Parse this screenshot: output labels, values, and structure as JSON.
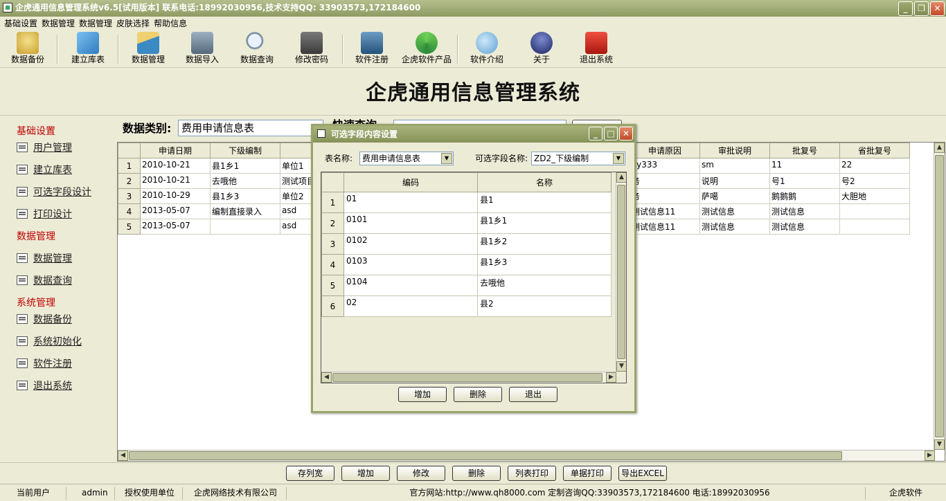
{
  "window": {
    "title": "企虎通用信息管理系统v6.5[试用版本]   联系电话:18992030956,技术支持QQ: 33903573,172184600"
  },
  "menu": [
    "基础设置",
    "数据管理",
    "数据管理",
    "皮肤选择",
    "帮助信息"
  ],
  "toolbar": [
    {
      "label": "数据备份",
      "icon": "database-backup-icon",
      "color": "#d9b23a"
    },
    {
      "label": "建立库表",
      "icon": "create-table-icon",
      "color": "#3c8fd8"
    },
    {
      "label": "数据管理",
      "icon": "data-manage-icon",
      "color": "#3b8ac4"
    },
    {
      "label": "数据导入",
      "icon": "data-import-icon",
      "color": "#6a7f95"
    },
    {
      "label": "数据查询",
      "icon": "magnifier-icon",
      "color": "#9fb4c7"
    },
    {
      "label": "修改密码",
      "icon": "key-icon",
      "color": "#5a5a5a"
    },
    {
      "label": "软件注册",
      "icon": "register-icon",
      "color": "#3a6f9c"
    },
    {
      "label": "企虎软件产品",
      "icon": "refresh-icon",
      "color": "#3fa04a"
    },
    {
      "label": "软件介绍",
      "icon": "chat-icon",
      "color": "#6ab0e0"
    },
    {
      "label": "关于",
      "icon": "about-icon",
      "color": "#2d3b7a"
    },
    {
      "label": "退出系统",
      "icon": "exit-icon",
      "color": "#d42a1e"
    }
  ],
  "banner": {
    "title": "企虎通用信息管理系统"
  },
  "sidebar": {
    "groups": [
      {
        "title": "基础设置",
        "items": [
          "用户管理",
          "建立库表",
          "可选字段设计",
          "打印设计"
        ]
      },
      {
        "title": "数据管理",
        "items": [
          "数据管理",
          "数据查询"
        ]
      },
      {
        "title": "系统管理",
        "items": [
          "数据备份",
          "系统初始化",
          "软件注册",
          "退出系统"
        ]
      }
    ]
  },
  "main": {
    "data_type_label": "数据类别:",
    "data_type_value": "费用申请信息表",
    "quick_query_label": "快速查询",
    "columns": [
      "",
      "申请日期",
      "下级编制",
      "单",
      "",
      "",
      "",
      "",
      "申请原因",
      "审批说明",
      "批复号",
      "省批复号"
    ],
    "rows": [
      [
        "1",
        "2010-10-21",
        "县1乡1",
        "单位1",
        "",
        "",
        "",
        "",
        "yy333",
        "sm",
        "11",
        "22"
      ],
      [
        "2",
        "2010-10-21",
        "去哦他",
        "测试项目",
        "",
        "",
        "",
        "",
        "务",
        "说明",
        "号1",
        "号2"
      ],
      [
        "3",
        "2010-10-29",
        "县1乡3",
        "单位2",
        "",
        "",
        "",
        "",
        "务",
        "萨噶",
        "鹅鹅鹅",
        "大胆地"
      ],
      [
        "4",
        "2013-05-07",
        "编制直接录入",
        "asd",
        "",
        "",
        "",
        "",
        "测试信息11",
        "测试信息",
        "测试信息",
        ""
      ],
      [
        "5",
        "2013-05-07",
        "",
        "asd",
        "",
        "",
        "",
        "",
        "测试信息11",
        "测试信息",
        "测试信息",
        ""
      ]
    ]
  },
  "bottom_buttons": [
    "存列宽",
    "增加",
    "修改",
    "删除",
    "列表打印",
    "单据打印",
    "导出EXCEL"
  ],
  "status": {
    "user_label": "当前用户",
    "user_value": "admin",
    "unit_label": "授权使用单位",
    "unit_value": "企虎网络技术有限公司",
    "contact": "官方网站:http://www.qh8000.com 定制咨询QQ:33903573,172184600 电话:18992030956",
    "brand": "企虎软件"
  },
  "dialog": {
    "title": "可选字段内容设置",
    "table_label": "表名称:",
    "table_value": "费用申请信息表",
    "field_label": "可选字段名称:",
    "field_value": "ZD2_下级编制",
    "columns": [
      "",
      "编码",
      "名称"
    ],
    "rows": [
      [
        "1",
        "01",
        "县1"
      ],
      [
        "2",
        "0101",
        "县1乡1"
      ],
      [
        "3",
        "0102",
        "县1乡2"
      ],
      [
        "4",
        "0103",
        "县1乡3"
      ],
      [
        "5",
        "0104",
        "去哦他"
      ],
      [
        "6",
        "02",
        "县2"
      ]
    ],
    "buttons": [
      "增加",
      "删除",
      "退出"
    ]
  }
}
